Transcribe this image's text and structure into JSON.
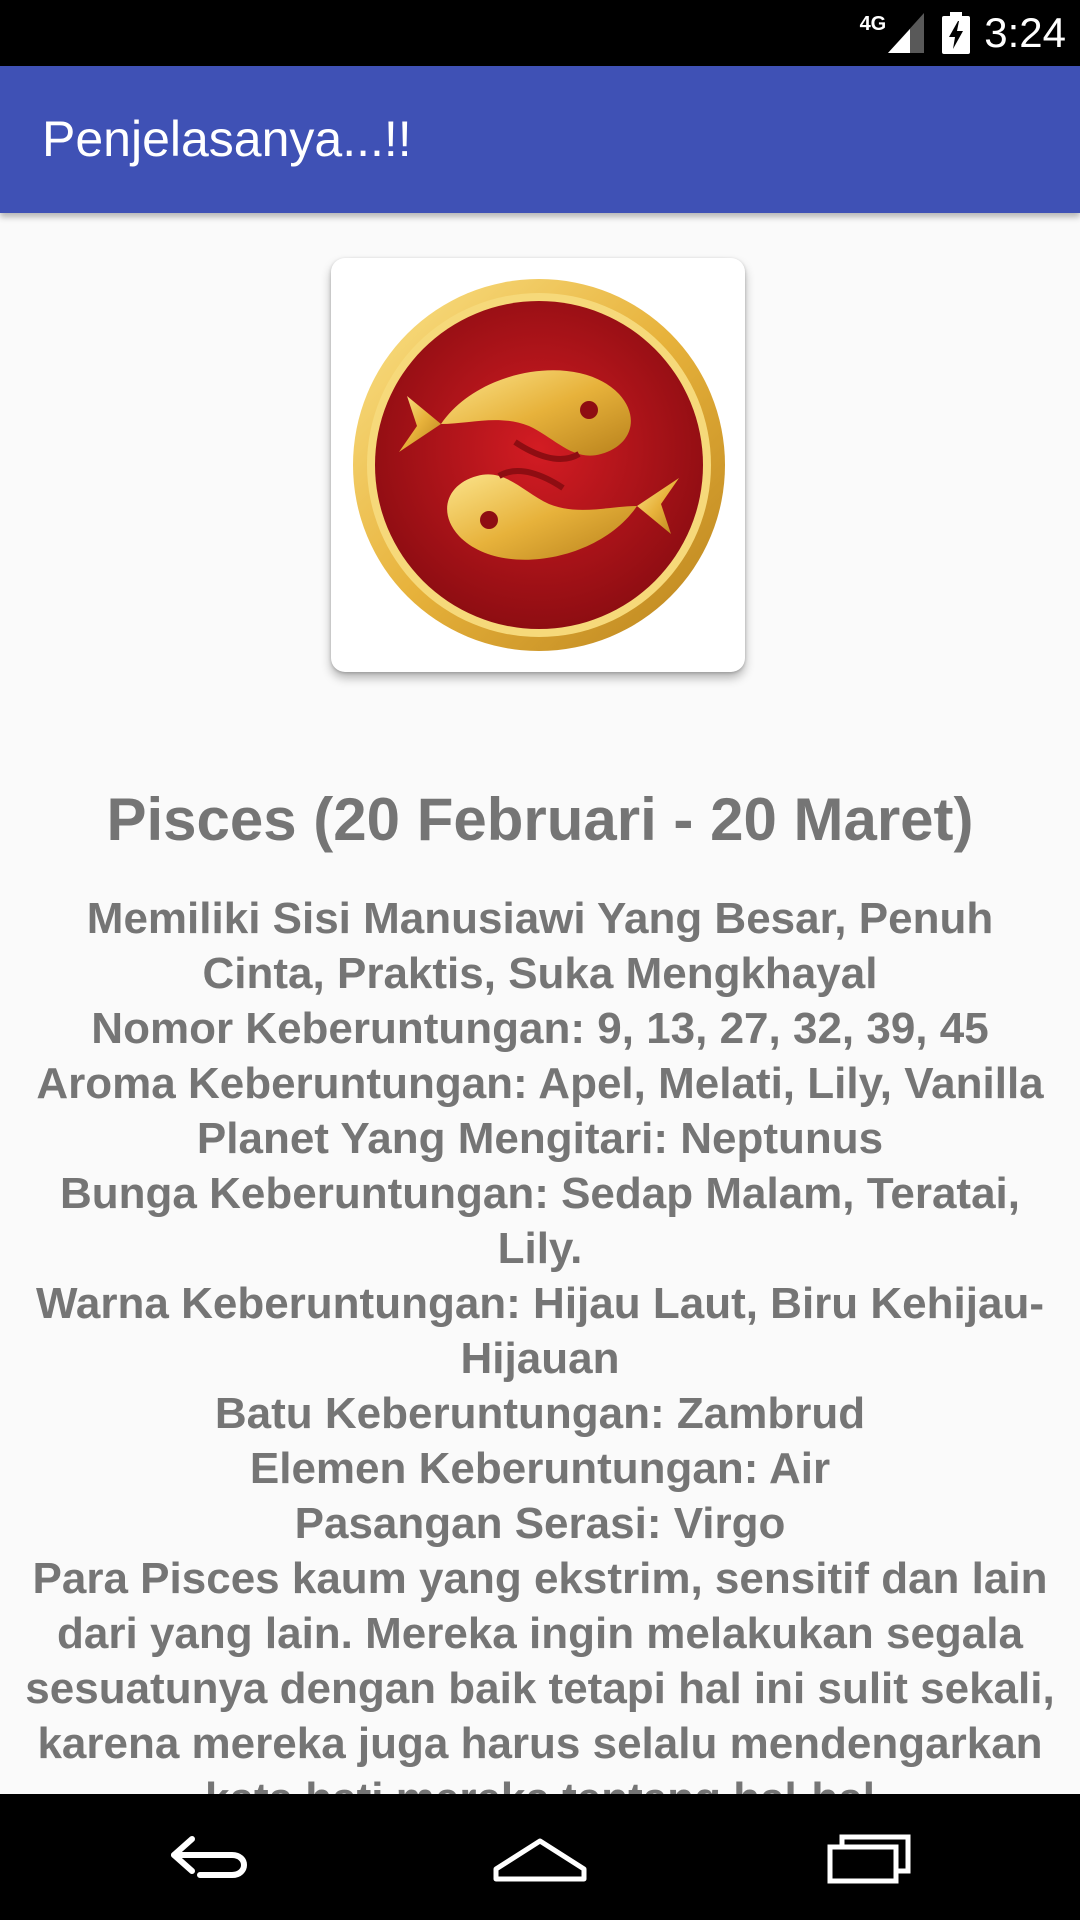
{
  "status_bar": {
    "network": "4G",
    "time": "3:24"
  },
  "app_bar": {
    "title": "Penjelasanya...!!"
  },
  "zodiac": {
    "image_icon": "pisces-icon",
    "heading": "Pisces (20 Februari - 20 Maret)",
    "description": "Memiliki Sisi Manusiawi Yang Besar, Penuh Cinta, Praktis, Suka Mengkhayal\nNomor Keberuntungan: 9, 13, 27, 32, 39, 45\nAroma Keberuntungan: Apel, Melati, Lily, Vanilla\nPlanet Yang Mengitari: Neptunus\nBunga Keberuntungan: Sedap Malam, Teratai, Lily.\nWarna Keberuntungan: Hijau Laut, Biru Kehijau-Hijauan\nBatu Keberuntungan: Zambrud\nElemen Keberuntungan: Air\nPasangan Serasi: Virgo\nPara Pisces kaum yang ekstrim, sensitif dan lain dari yang lain. Mereka ingin melakukan segala sesuatunya dengan baik tetapi hal ini sulit sekali, karena mereka juga harus selalu mendengarkan kata hati mereka tentang hal-hal"
  },
  "nav_bar": {
    "back_icon": "back-icon",
    "home_icon": "home-icon",
    "recents_icon": "recents-icon"
  },
  "colors": {
    "app_bar": "#3f51b5",
    "text": "#757575",
    "emblem_red": "#b5121b",
    "emblem_gold": "#e8b23a"
  }
}
